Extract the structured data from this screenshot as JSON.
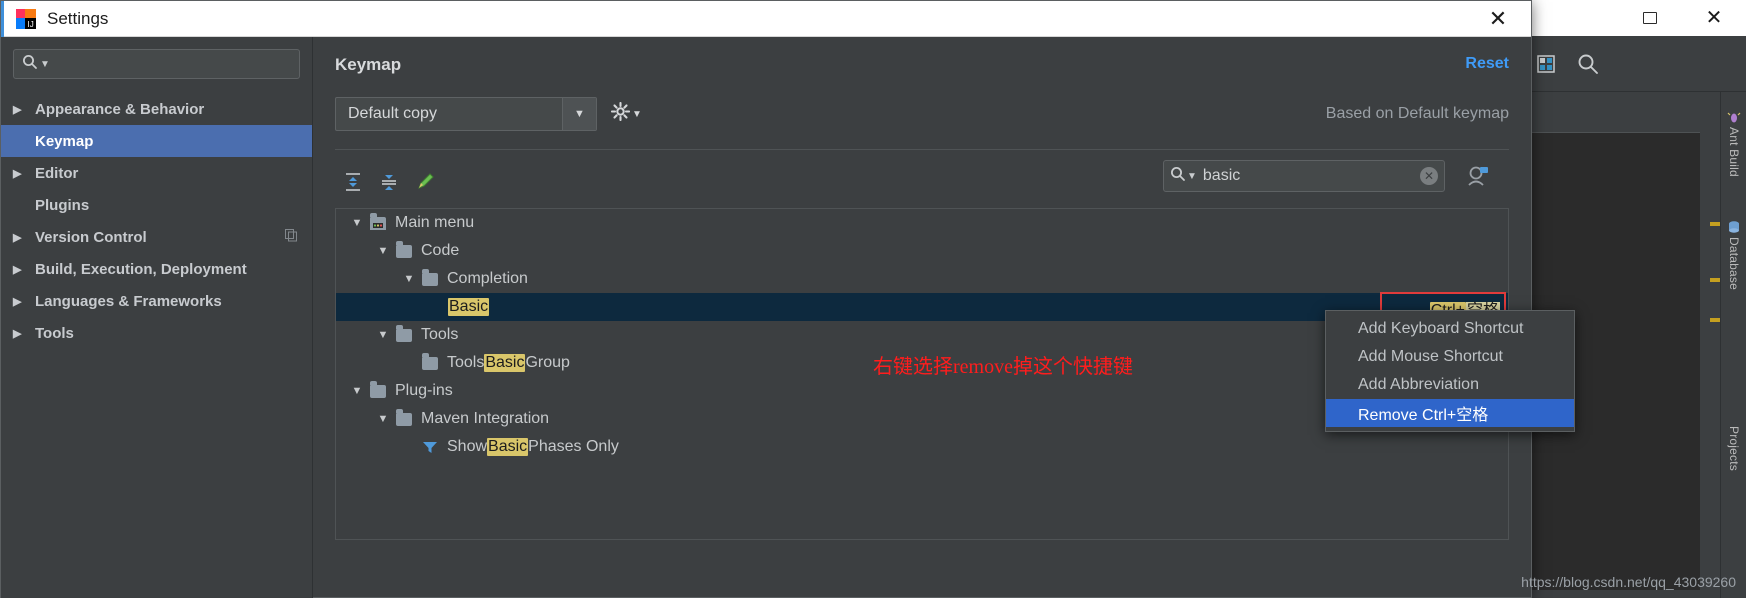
{
  "ide": {
    "window_buttons": [
      {
        "name": "restore",
        "glyph": "❐"
      },
      {
        "name": "close",
        "glyph": "✕"
      }
    ],
    "toolbar_icons": [
      "branch-icon",
      "run-with-coverage-icon",
      "undo-icon",
      "layout-icon",
      "search-everywhere-icon"
    ],
    "right_strip": [
      "Ant Build",
      "Database",
      "Projects"
    ],
    "watermark": "https://blog.csdn.net/qq_43039260"
  },
  "dialog": {
    "title": "Settings",
    "close_glyph": "✕",
    "accent_color": "#3f8fd9"
  },
  "sidebar": {
    "search_placeholder": "",
    "search_value": "",
    "items": [
      {
        "label": "Appearance & Behavior",
        "expandable": true,
        "selected": false,
        "badge": ""
      },
      {
        "label": "Keymap",
        "expandable": false,
        "selected": true,
        "badge": ""
      },
      {
        "label": "Editor",
        "expandable": true,
        "selected": false,
        "badge": ""
      },
      {
        "label": "Plugins",
        "expandable": false,
        "selected": false,
        "badge": ""
      },
      {
        "label": "Version Control",
        "expandable": true,
        "selected": false,
        "badge": "⬚"
      },
      {
        "label": "Build, Execution, Deployment",
        "expandable": true,
        "selected": false,
        "badge": ""
      },
      {
        "label": "Languages & Frameworks",
        "expandable": true,
        "selected": false,
        "badge": ""
      },
      {
        "label": "Tools",
        "expandable": true,
        "selected": false,
        "badge": ""
      }
    ]
  },
  "main": {
    "title": "Keymap",
    "reset_label": "Reset",
    "keymap_selected": "Default copy",
    "based_on": "Based on Default keymap",
    "toolbar": {
      "expand_all": "expand-all-icon",
      "collapse_all": "collapse-all-icon",
      "edit": "edit-pencil-icon"
    },
    "search": {
      "value": "basic",
      "placeholder": "",
      "clear_glyph": "✕",
      "filter_icon": "shortcut-filter-icon"
    },
    "tree": [
      {
        "indent": 0,
        "twisty": "▼",
        "icon": "main-menu-icon",
        "pre": "",
        "hl": "",
        "post": "Main menu",
        "selected": false,
        "shortcut": ""
      },
      {
        "indent": 1,
        "twisty": "▼",
        "icon": "folder-icon",
        "pre": "",
        "hl": "",
        "post": "Code",
        "selected": false,
        "shortcut": ""
      },
      {
        "indent": 2,
        "twisty": "▼",
        "icon": "folder-icon",
        "pre": "",
        "hl": "",
        "post": "Completion",
        "selected": false,
        "shortcut": ""
      },
      {
        "indent": 3,
        "twisty": "",
        "icon": "",
        "pre": "",
        "hl": "Basic",
        "post": "",
        "selected": true,
        "shortcut": "Ctrl+空格"
      },
      {
        "indent": 1,
        "twisty": "▼",
        "icon": "folder-icon",
        "pre": "",
        "hl": "",
        "post": "Tools",
        "selected": false,
        "shortcut": ""
      },
      {
        "indent": 2,
        "twisty": "",
        "icon": "folder-icon",
        "pre": "Tools ",
        "hl": "Basic",
        "post": " Group",
        "selected": false,
        "shortcut": ""
      },
      {
        "indent": 0,
        "twisty": "▼",
        "icon": "folder-icon",
        "pre": "",
        "hl": "",
        "post": "Plug-ins",
        "selected": false,
        "shortcut": ""
      },
      {
        "indent": 1,
        "twisty": "▼",
        "icon": "folder-icon",
        "pre": "",
        "hl": "",
        "post": "Maven Integration",
        "selected": false,
        "shortcut": ""
      },
      {
        "indent": 2,
        "twisty": "",
        "icon": "filter-icon",
        "pre": "Show ",
        "hl": "Basic",
        "post": " Phases Only",
        "selected": false,
        "shortcut": ""
      }
    ],
    "shortcut_badge": {
      "prefix": "Ctrl+",
      "suffix": "空格"
    },
    "annotation": "右键选择remove掉这个快捷键"
  },
  "context_menu": {
    "items": [
      {
        "label": "Add Keyboard Shortcut",
        "active": false
      },
      {
        "label": "Add Mouse Shortcut",
        "active": false
      },
      {
        "label": "Add Abbreviation",
        "active": false
      },
      {
        "label": "Remove Ctrl+空格",
        "active": true
      }
    ]
  },
  "colors": {
    "accent_blue": "#4b6eaf",
    "link_blue": "#3f9bf7",
    "menu_active": "#2f65ca",
    "highlight_yellow": "#d9c66a",
    "annotation_red": "#ff1d1d",
    "selected_row": "#0d293e"
  }
}
